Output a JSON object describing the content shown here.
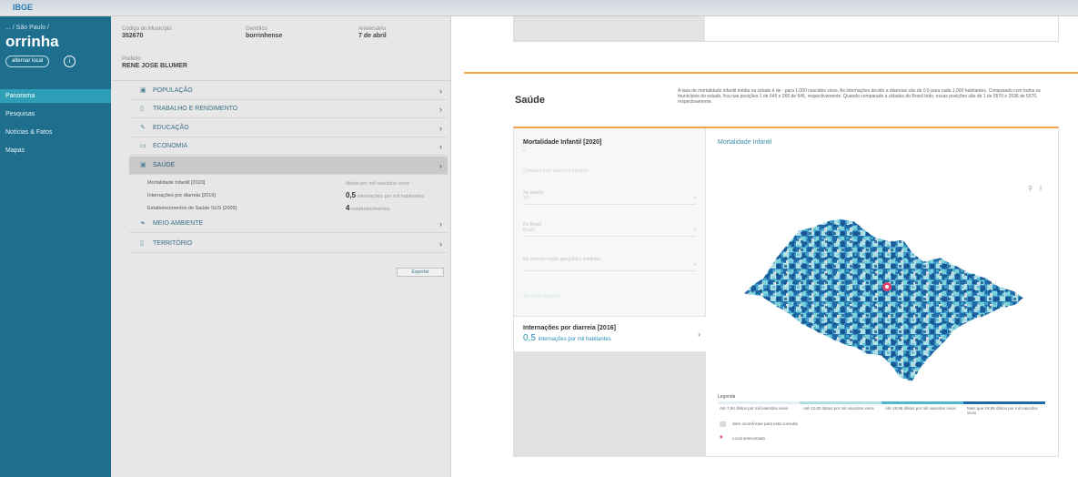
{
  "topbar": {
    "brand": "IBGE",
    "crumbs": ""
  },
  "nav": {
    "location": "... / São Paulo /",
    "city": "orrinha",
    "switch_label": "alternar local",
    "info_icon": "i",
    "items": [
      "Panorama",
      "Pesquisas",
      "Notícias & Fatos",
      "Mapas"
    ]
  },
  "header": {
    "code_label": "Código do Município",
    "code_value": "352670",
    "gentilic_label": "Gentílico",
    "gentilic_value": "borrinhense",
    "mayor_label": "Prefeito",
    "mayor_value": "RENE JOSE BLUMER",
    "anniversary_label": "Aniversário",
    "anniversary_value": "7 de abril"
  },
  "themes": [
    {
      "icon": "people-icon",
      "glyph": "▣",
      "label": "POPULAÇÃO"
    },
    {
      "icon": "work-icon",
      "glyph": "▯",
      "label": "TRABALHO E RENDIMENTO"
    },
    {
      "icon": "education-icon",
      "glyph": "✎",
      "label": "EDUCAÇÃO"
    },
    {
      "icon": "economy-icon",
      "glyph": "▭",
      "label": "ECONOMIA"
    },
    {
      "icon": "health-icon",
      "glyph": "▣",
      "label": "SAÚDE"
    },
    {
      "icon": "environment-icon",
      "glyph": "❧",
      "label": "MEIO AMBIENTE"
    },
    {
      "icon": "territory-icon",
      "glyph": "▯",
      "label": "TERRITÓRIO"
    }
  ],
  "health_rows": [
    {
      "label": "Mortalidade Infantil [2020]",
      "value": "",
      "unit": "óbitos por mil nascidos vivos"
    },
    {
      "label": "Internações por diarreia [2016]",
      "value": "0,5",
      "unit": "internações por mil habitantes"
    },
    {
      "label": "Estabelecimentos de Saúde SUS [2009]",
      "value": "4",
      "unit": "estabelecimentos"
    }
  ],
  "export_label": "Exportar",
  "section": {
    "title": "Saúde",
    "description": "A taxa de mortalidade infantil média na cidade é de - para 1.000 nascidos vivos. As internações devido a diarreias são de 0.5 para cada 1.000 habitantes. Comparado com todos os municípios do estado, fica nas posições 1 de 645 e 266 de 645, respectivamente. Quando comparado a cidades do Brasil todo, essas posições são de 1 de 5570 e 2536 de 5570, respectivamente."
  },
  "card": {
    "stat_title": "Mortalidade Infantil [2020]",
    "stat_value": "-",
    "hint": "Compare com outros municípios",
    "fields": [
      {
        "label": "No estado",
        "value": "SP"
      },
      {
        "label": "No Brasil",
        "value": "Brasil"
      },
      {
        "label": "Na mesma região geográfica imediata",
        "value": "-"
      }
    ],
    "link": "Ver série histórica",
    "stat2_title": "Internações por diarreia [2016]",
    "stat2_value": "0,5",
    "stat2_unit": "internações por mil habitantes",
    "map_title": "Mortalidade Infantil",
    "zoom_glyph": "⚲",
    "download_glyph": "⇩",
    "legend_title": "Legenda",
    "legend_items": [
      "Até 7,84 óbitos por mil nascidos vivos",
      "Até 12,82 óbitos por mil nascidos vivos",
      "Até 18,95 óbitos por mil nascidos vivos",
      "Mais que 18,95 óbitos por mil nascidos vivos"
    ],
    "legend_nodata": "Sem ocorrências para esta consulta",
    "legend_pin": "Local selecionado"
  },
  "colors": {
    "nav": "#1e6f8e",
    "accent": "#f0a44a",
    "map_dark": "#1f6aa8",
    "map_mid": "#4fb7d1",
    "map_light": "#aee0e6",
    "pin": "#e2436c"
  }
}
